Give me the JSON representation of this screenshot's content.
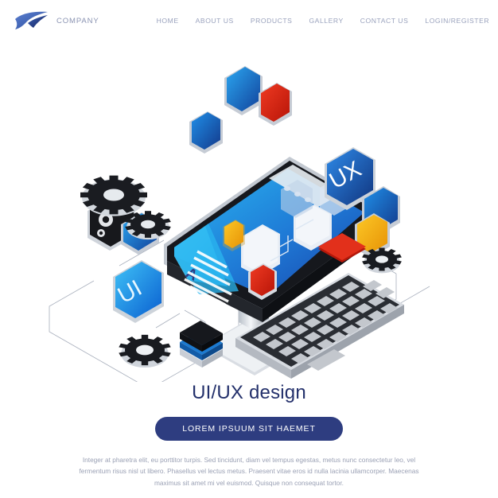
{
  "header": {
    "logo_icon": "wing-logo-icon",
    "brand_name": "COMPANY",
    "nav_items": [
      {
        "label": "HOME"
      },
      {
        "label": "ABOUT US"
      },
      {
        "label": "PRODUCTS"
      },
      {
        "label": "GALLERY"
      },
      {
        "label": "CONTACT US"
      },
      {
        "label": "LOGIN/REGISTER"
      }
    ]
  },
  "illustration": {
    "alt": "isometric UI/UX design workstation illustration",
    "screen_letter": "A",
    "badge_ui": "UI",
    "badge_ux": "UX",
    "elements": [
      "desktop-monitor",
      "keyboard",
      "gear-large",
      "gear-medium",
      "gear-small-left",
      "gear-small-right",
      "settings-badge",
      "ui-badge",
      "ux-badge",
      "layer-stack",
      "floating-tile-blue",
      "floating-tile-red",
      "floating-tile-yellow"
    ]
  },
  "footer": {
    "headline": "UI/UX design",
    "cta_label": "LOREM IPSUUM SIT HAEMET",
    "body_copy": "Integer at pharetra elit, eu porttitor turpis. Sed tincidunt, diam vel tempus egestas, metus nunc consectetur leo, vel fermentum risus nisl ut libero. Phasellus vel lectus metus. Praesent vitae eros id nulla lacinia ullamcorper. Maecenas maximus sit amet mi vel euismod. Quisque non consequat tortor."
  },
  "colors": {
    "brand_navy": "#23306b",
    "cta_navy": "#2e3d80",
    "nav_gray": "#9aa2bd",
    "body_gray": "#9aa0b4",
    "accent_blue": "#1b8ae0",
    "accent_cyan": "#29c0f0",
    "accent_red": "#dd2a18",
    "accent_yellow": "#f6b01e",
    "dark": "#1b1d22",
    "page_bg": "#ffffff"
  }
}
